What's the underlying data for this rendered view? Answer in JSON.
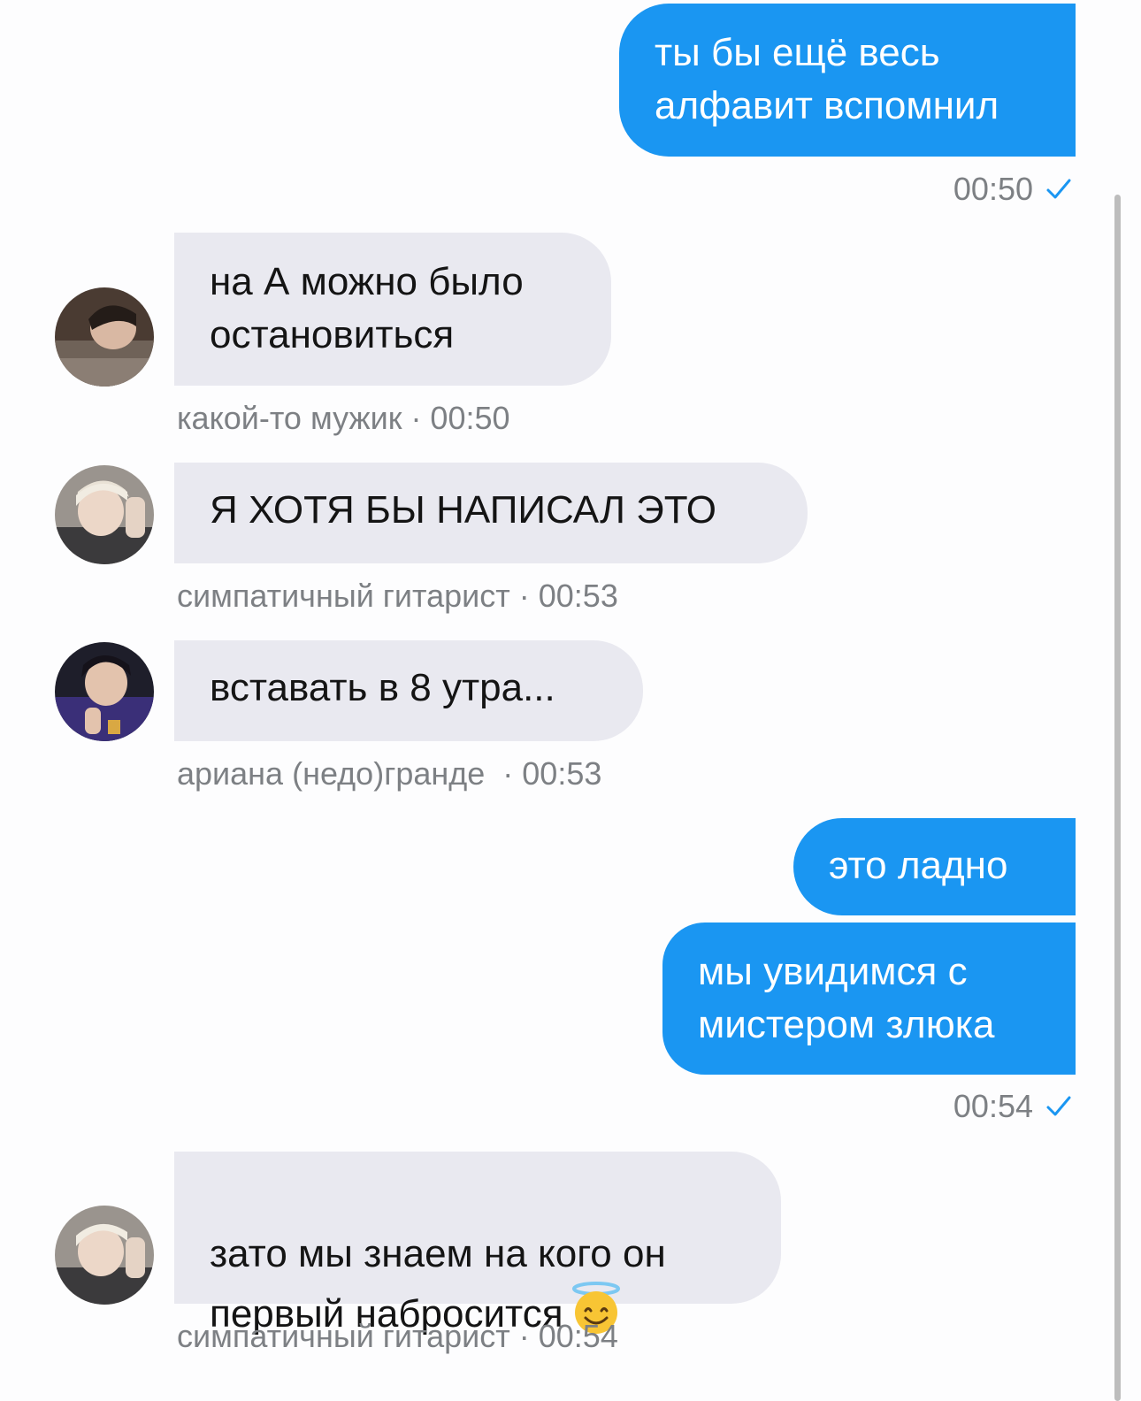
{
  "messages": [
    {
      "direction": "out",
      "text": "ты бы ещё весь\nалфавит вспомнил",
      "time": "00:50",
      "status_icon": "check-icon"
    },
    {
      "direction": "in",
      "text": "на А можно было\nостановиться",
      "sender": "какой-то мужик",
      "time": "00:50",
      "meta": "какой-то мужик · 00:50"
    },
    {
      "direction": "in",
      "text": "Я ХОТЯ БЫ НАПИСАЛ ЭТО",
      "sender": "симпатичный гитарист",
      "time": "00:53",
      "meta": "симпатичный гитарист · 00:53"
    },
    {
      "direction": "in",
      "text": "вставать в 8 утра...",
      "sender": "ариана (недо)гранде",
      "time": "00:53",
      "meta": "ариана (недо)гранде  · 00:53"
    },
    {
      "direction": "out",
      "text": "это ладно"
    },
    {
      "direction": "out",
      "text": "мы увидимся с\nмистером злюка",
      "time": "00:54",
      "status_icon": "check-icon"
    },
    {
      "direction": "in",
      "text": "зато мы знаем на кого он\nпервый набросится",
      "emoji": "smiling-face-with-halo-icon",
      "sender": "симпатичный гитарист",
      "time": "00:54",
      "meta": "симпатичный гитарист · 00:54"
    }
  ],
  "colors": {
    "outgoing_bubble": "#1a96f2",
    "incoming_bubble": "#e9e9f0",
    "meta_text": "#7d8084",
    "check_mark": "#1a96f2",
    "background": "#fdfdfe"
  }
}
